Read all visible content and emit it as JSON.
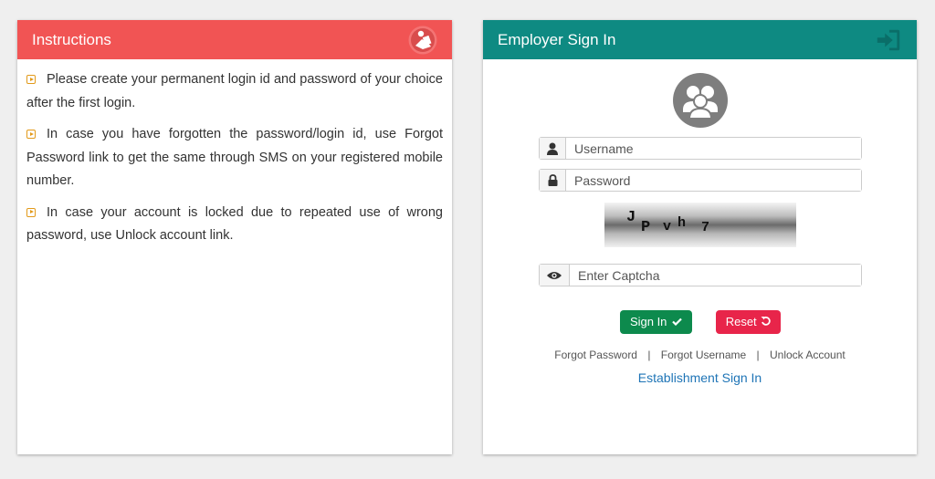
{
  "instructions": {
    "title": "Instructions",
    "icon": "reader-icon",
    "items": [
      "Please create your permanent login id and password of your choice after the first login.",
      "In case you have forgotten the password/login id, use Forgot Password link to get the same through SMS on your registered mobile number.",
      "In case your account is locked due to repeated use of wrong password, use Unlock account link."
    ]
  },
  "signin": {
    "title": "Employer Sign In",
    "username_placeholder": "Username",
    "password_placeholder": "Password",
    "captcha_text": "J P v h 7",
    "captcha_placeholder": "Enter Captcha",
    "signin_label": "Sign In",
    "reset_label": "Reset",
    "links": {
      "forgot_password": "Forgot Password",
      "forgot_username": "Forgot Username",
      "unlock_account": "Unlock Account",
      "separator": "|"
    },
    "establishment_link": "Establishment Sign In"
  },
  "colors": {
    "instructions_header": "#f15454",
    "signin_header": "#0e8a82",
    "signin_button": "#0d8a4d",
    "reset_button": "#e8254a",
    "link": "#1e74b6"
  }
}
